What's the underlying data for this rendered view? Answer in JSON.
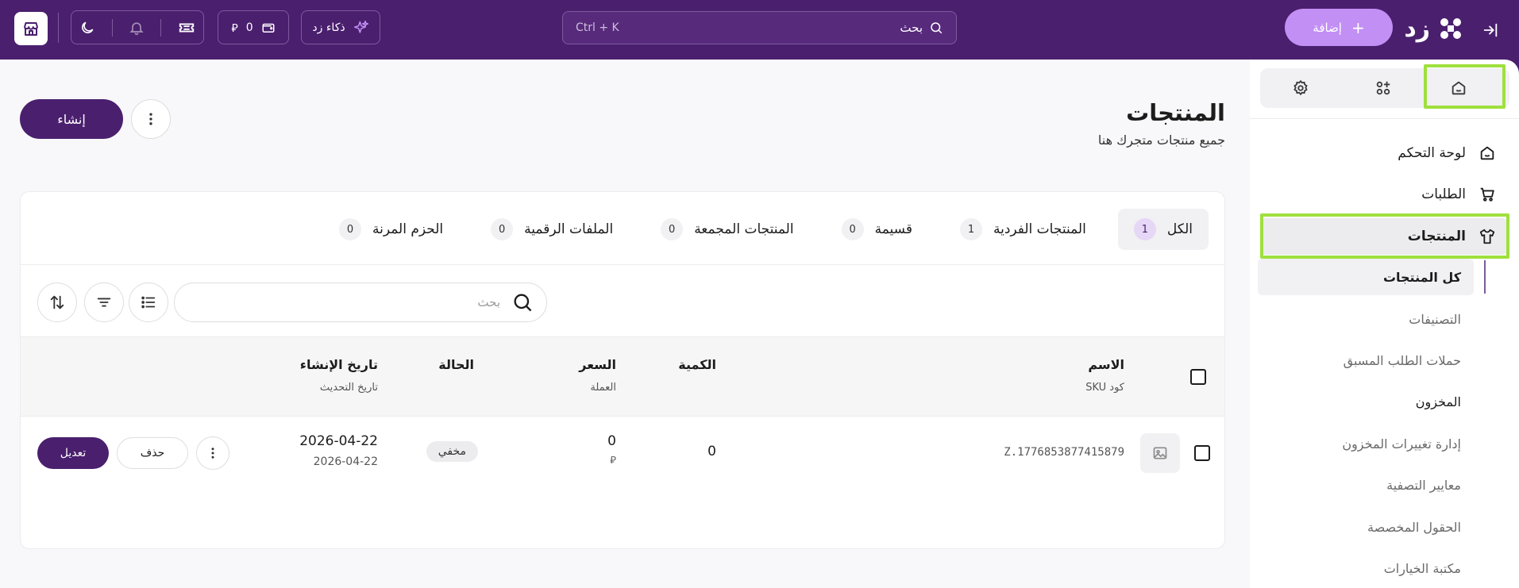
{
  "topbar": {
    "brand": "زد",
    "add_label": "إضافة",
    "search_label": "بحث",
    "search_hint": "Ctrl + K",
    "ai_label": "ذكاء زد",
    "wallet_amount": "0",
    "currency_symbol": "⃁"
  },
  "sidebar": {
    "tabs": [
      {
        "name": "home",
        "icon": "home-icon"
      },
      {
        "name": "apps",
        "icon": "apps-add-icon"
      },
      {
        "name": "settings",
        "icon": "gear-icon"
      }
    ],
    "nav": {
      "dashboard": "لوحة التحكم",
      "orders": "الطلبات",
      "products": "المنتجات"
    },
    "sub": {
      "all_products": "كل المنتجات",
      "categories": "التصنيفات",
      "preorder": "حملات الطلب المسبق",
      "inventory": "المخزون",
      "inventory_changes": "إدارة تغييرات المخزون",
      "filters": "معايير التصفية",
      "custom_fields": "الحقول المخصصة",
      "options_library": "مكتبة الخيارات"
    }
  },
  "main": {
    "title": "المنتجات",
    "subtitle": "جميع منتجات متجرك هنا",
    "create_label": "إنشاء",
    "filter_tabs": [
      {
        "label": "الكل",
        "count": "1"
      },
      {
        "label": "المنتجات الفردية",
        "count": "1"
      },
      {
        "label": "قسيمة",
        "count": "0"
      },
      {
        "label": "المنتجات المجمعة",
        "count": "0"
      },
      {
        "label": "الملفات الرقمية",
        "count": "0"
      },
      {
        "label": "الحزم المرنة",
        "count": "0"
      }
    ],
    "search_placeholder": "بحث",
    "table": {
      "headers": {
        "name": "الاسم",
        "sku": "كود SKU",
        "quantity": "الكمية",
        "price": "السعر",
        "currency": "العملة",
        "status": "الحالة",
        "created": "تاريخ الإنشاء",
        "updated": "تاريخ التحديث"
      },
      "rows": [
        {
          "sku": "Z.1776853877415879",
          "quantity": "0",
          "price": "0",
          "currency": "⃁",
          "status": "مخفي",
          "created": "2026-04-22",
          "updated": "2026-04-22",
          "delete_label": "حذف",
          "edit_label": "تعديل"
        }
      ]
    }
  },
  "colors": {
    "brand_purple": "#4a1f6e",
    "accent_lilac": "#c28ff5",
    "highlight_green": "#9fe03d"
  }
}
